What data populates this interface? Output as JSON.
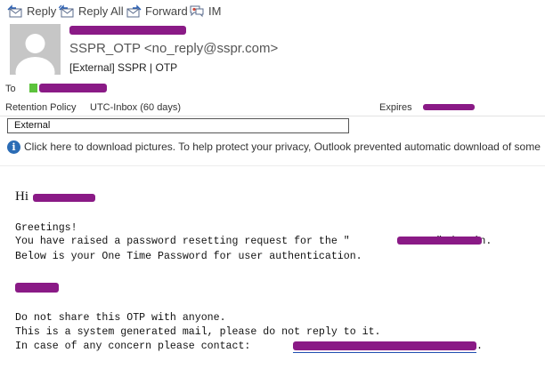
{
  "toolbar": {
    "reply": "Reply",
    "reply_all": "Reply All",
    "forward": "Forward",
    "im": "IM"
  },
  "header": {
    "sender": "SSPR_OTP <no_reply@sspr.com>",
    "subject": "[External] SSPR | OTP",
    "to_label": "To",
    "retention_label": "Retention Policy",
    "retention_value": "UTC-Inbox (60 days)",
    "expires_label": "Expires",
    "tag": "External"
  },
  "info_bar": {
    "text": "Click here to download pictures. To help protect your privacy, Outlook prevented automatic download of some"
  },
  "body": {
    "greeting": "Hi",
    "line1": "Greetings!",
    "line2a": "You have raised a password resetting request for the \"",
    "line2b": "\" domain.",
    "line3": "Below is your One Time Password for user authentication.",
    "line4": "Do not share this OTP with anyone.",
    "line5": "This is a system generated mail, please do not reply to it.",
    "line6": "In case of any concern please contact:",
    "line6_end": "."
  },
  "colors": {
    "redaction": "#8a1a86",
    "presence": "#5cc23c",
    "info_icon": "#2b6cb5",
    "link": "#1f4fb0"
  }
}
